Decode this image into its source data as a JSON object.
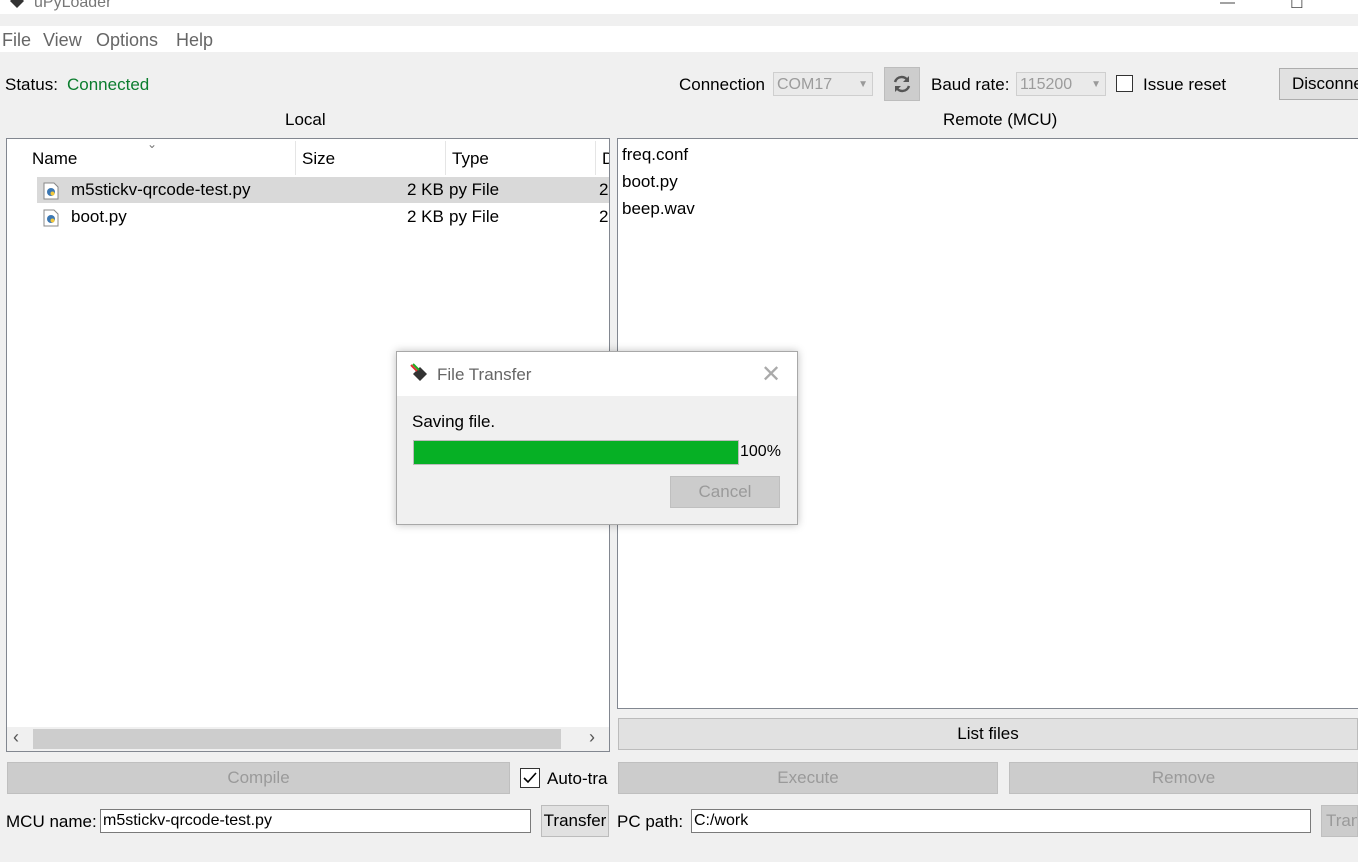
{
  "window": {
    "title": "uPyLoader"
  },
  "menu": [
    "File",
    "View",
    "Options",
    "Help"
  ],
  "status": {
    "label": "Status:",
    "value": "Connected",
    "value_color": "#0b7d2e"
  },
  "connection": {
    "label": "Connection",
    "port": "COM17",
    "baud_label": "Baud rate:",
    "baud": "115200",
    "issue_reset_label": "Issue reset",
    "issue_reset_checked": false,
    "disconnect_label": "Disconne"
  },
  "local": {
    "title": "Local",
    "columns": [
      "Name",
      "Size",
      "Type",
      "D"
    ],
    "files": [
      {
        "name": "m5stickv-qrcode-test.py",
        "size": "2 KB",
        "type": "py File",
        "date": "2",
        "selected": true
      },
      {
        "name": "boot.py",
        "size": "2 KB",
        "type": "py File",
        "date": "2",
        "selected": false
      }
    ],
    "compile_label": "Compile",
    "auto_transfer_label": "Auto-tra",
    "auto_transfer_checked": true,
    "mcu_name_label": "MCU name:",
    "mcu_name_value": "m5stickv-qrcode-test.py",
    "transfer_label": "Transfer"
  },
  "remote": {
    "title": "Remote (MCU)",
    "files": [
      "freq.conf",
      "boot.py",
      "beep.wav"
    ],
    "list_files_label": "List files",
    "execute_label": "Execute",
    "remove_label": "Remove",
    "pc_path_label": "PC path:",
    "pc_path_value": "C:/work",
    "transfer_label": "Tran"
  },
  "dialog": {
    "title": "File Transfer",
    "message": "Saving file.",
    "progress": 100,
    "progress_text": "100%",
    "progress_color": "#06b025",
    "cancel_label": "Cancel"
  },
  "icons": {
    "app": "upyloader-icon",
    "refresh": "refresh-icon",
    "file": "python-file-icon",
    "close": "close-icon"
  }
}
